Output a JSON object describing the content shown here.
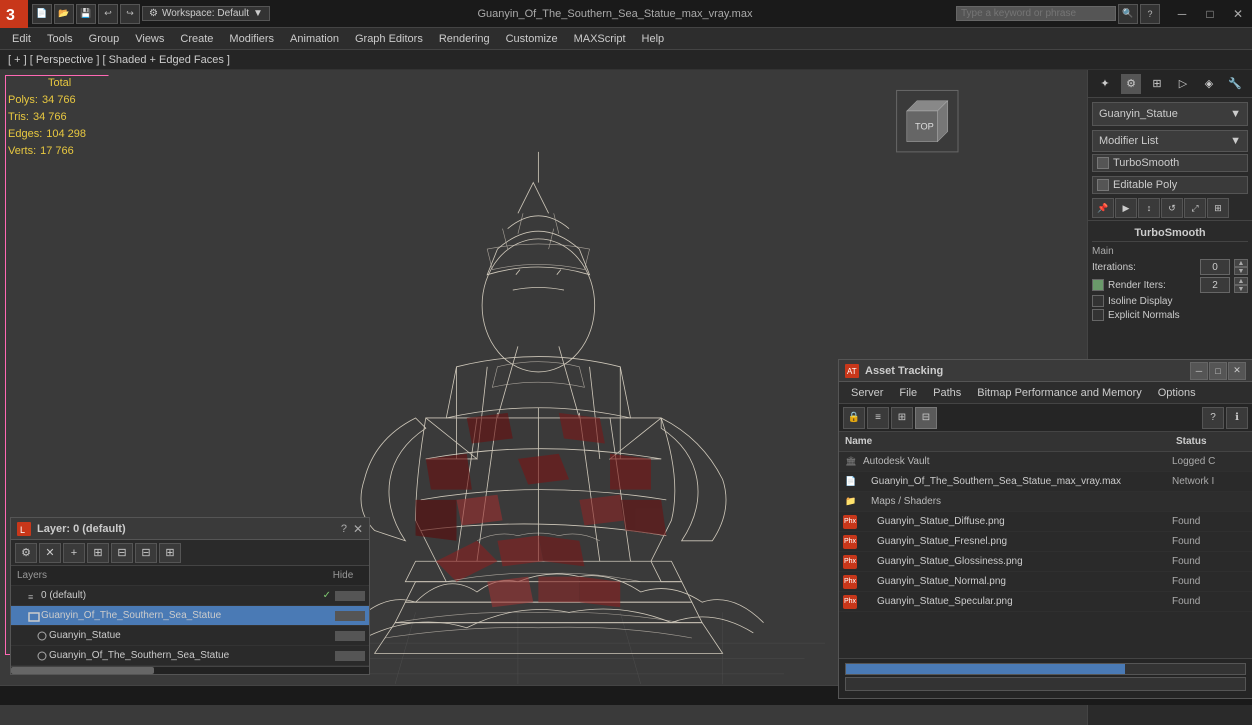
{
  "titlebar": {
    "logo": "3",
    "title": "Guanyin_Of_The_Southern_Sea_Statue_max_vray.max",
    "search_placeholder": "Type a keyword or phrase",
    "workspace_label": "Workspace: Default",
    "min_btn": "─",
    "max_btn": "□",
    "close_btn": "✕"
  },
  "menubar": {
    "items": [
      "Edit",
      "Tools",
      "Group",
      "Views",
      "Create",
      "Modifiers",
      "Animation",
      "Graph Editors",
      "Rendering",
      "Customize",
      "MAXScript",
      "Help"
    ]
  },
  "viewport": {
    "label": "[ + ] [ Perspective ] [ Shaded + Edged Faces ]"
  },
  "stats": {
    "total_label": "Total",
    "polys_label": "Polys:",
    "polys_value": "34 766",
    "tris_label": "Tris:",
    "tris_value": "34 766",
    "edges_label": "Edges:",
    "edges_value": "104 298",
    "verts_label": "Verts:",
    "verts_value": "17 766"
  },
  "right_panel": {
    "object_name": "Guanyin_Statue",
    "modifier_list_label": "Modifier List",
    "modifiers": [
      {
        "name": "TurboSmooth",
        "checked": false
      },
      {
        "name": "Editable Poly",
        "checked": false
      }
    ],
    "turbosmooth": {
      "section_label": "TurboSmooth",
      "main_label": "Main",
      "iterations_label": "Iterations:",
      "iterations_value": "0",
      "render_iters_label": "Render Iters:",
      "render_iters_value": "2",
      "isoline_label": "Isoline Display",
      "explicit_label": "Explicit Normals"
    }
  },
  "layer_panel": {
    "title": "Layer: 0 (default)",
    "question_mark": "?",
    "close": "✕",
    "col_layers": "Layers",
    "col_hide": "Hide",
    "rows": [
      {
        "indent": 0,
        "type": "layer",
        "name": "0 (default)",
        "checked": true,
        "selected": false
      },
      {
        "indent": 0,
        "type": "object",
        "name": "Guanyin_Of_The_Southern_Sea_Statue",
        "checked": false,
        "selected": true
      },
      {
        "indent": 1,
        "type": "object",
        "name": "Guanyin_Statue",
        "checked": false,
        "selected": false
      },
      {
        "indent": 1,
        "type": "object",
        "name": "Guanyin_Of_The_Southern_Sea_Statue",
        "checked": false,
        "selected": false
      }
    ]
  },
  "asset_panel": {
    "title": "Asset Tracking",
    "menubar": [
      "Server",
      "File",
      "Paths",
      "Bitmap Performance and Memory",
      "Options"
    ],
    "col_name": "Name",
    "col_status": "Status",
    "rows": [
      {
        "indent": 0,
        "type": "vault",
        "name": "Autodesk Vault",
        "status": "Logged C",
        "icon": "🏛"
      },
      {
        "indent": 1,
        "type": "file",
        "name": "Guanyin_Of_The_Southern_Sea_Statue_max_vray.max",
        "status": "Network I",
        "icon": "📄"
      },
      {
        "indent": 1,
        "type": "folder",
        "name": "Maps / Shaders",
        "status": "",
        "icon": "📁"
      },
      {
        "indent": 2,
        "type": "texture",
        "name": "Guanyin_Statue_Diffuse.png",
        "status": "Found",
        "icon": "🖼"
      },
      {
        "indent": 2,
        "type": "texture",
        "name": "Guanyin_Statue_Fresnel.png",
        "status": "Found",
        "icon": "🖼"
      },
      {
        "indent": 2,
        "type": "texture",
        "name": "Guanyin_Statue_Glossiness.png",
        "status": "Found",
        "icon": "🖼"
      },
      {
        "indent": 2,
        "type": "texture",
        "name": "Guanyin_Statue_Normal.png",
        "status": "Found",
        "icon": "🖼"
      },
      {
        "indent": 2,
        "type": "texture",
        "name": "Guanyin_Statue_Specular.png",
        "status": "Found",
        "icon": "🖼"
      }
    ]
  }
}
